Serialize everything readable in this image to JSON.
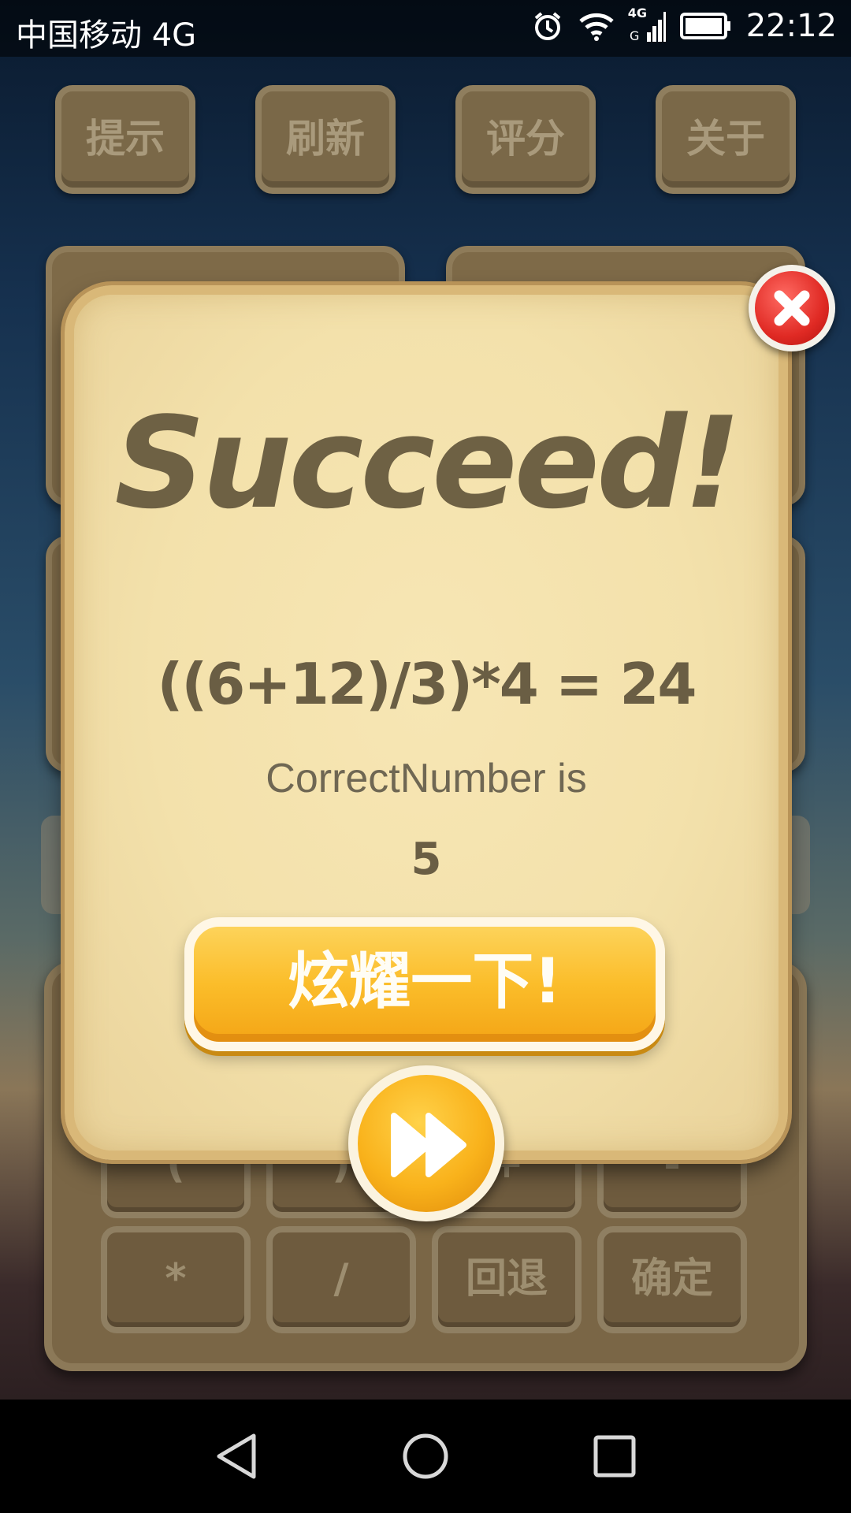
{
  "status_bar": {
    "carrier": "中国移动 4G",
    "network_type": "4G",
    "time": "22:12",
    "icons": [
      "alarm-icon",
      "wifi-icon",
      "signal-icon",
      "battery-icon"
    ]
  },
  "top_buttons": [
    {
      "label": "提示"
    },
    {
      "label": "刷新"
    },
    {
      "label": "评分"
    },
    {
      "label": "关于"
    }
  ],
  "keypad": {
    "row1": [
      "(",
      ")",
      "+",
      "-"
    ],
    "row2": [
      "*",
      "/",
      "回退",
      "确定"
    ]
  },
  "dialog": {
    "title": "Succeed!",
    "formula": "((6+12)/3)*4 = 24",
    "correct_label": "CorrectNumber is",
    "correct_value": "5",
    "share_button": "炫耀一下!",
    "close_icon": "close-icon",
    "next_icon": "fast-forward-icon"
  },
  "colors": {
    "dialog_bg": "#f3e1ab",
    "text_brown": "#6e6144",
    "share_yellow": "#fbbd2a",
    "close_red": "#e02a24"
  },
  "nav_bar": {
    "icons": [
      "back-icon",
      "home-icon",
      "recents-icon"
    ]
  }
}
